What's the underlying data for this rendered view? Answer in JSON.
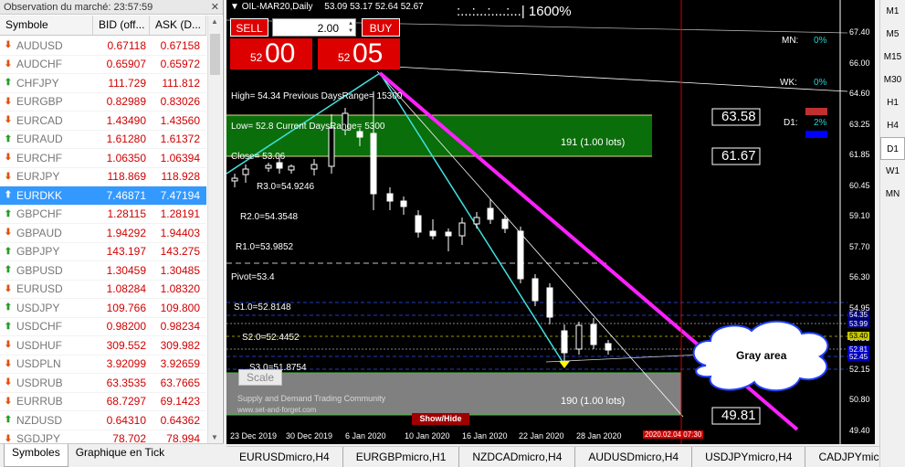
{
  "market_watch": {
    "title": "Observation du marché: 23:57:59",
    "close_icon": "close-icon",
    "columns": [
      "Symbole",
      "BID (off...",
      "ASK (D..."
    ],
    "rows": [
      {
        "symbol": "AUDUSD",
        "bid": "0.67118",
        "ask": "0.67158",
        "dir": "down"
      },
      {
        "symbol": "AUDCHF",
        "bid": "0.65907",
        "ask": "0.65972",
        "dir": "down"
      },
      {
        "symbol": "CHFJPY",
        "bid": "111.729",
        "ask": "111.812",
        "dir": "up"
      },
      {
        "symbol": "EURGBP",
        "bid": "0.82989",
        "ask": "0.83026",
        "dir": "down"
      },
      {
        "symbol": "EURCAD",
        "bid": "1.43490",
        "ask": "1.43560",
        "dir": "down"
      },
      {
        "symbol": "EURAUD",
        "bid": "1.61280",
        "ask": "1.61372",
        "dir": "up"
      },
      {
        "symbol": "EURCHF",
        "bid": "1.06350",
        "ask": "1.06394",
        "dir": "down"
      },
      {
        "symbol": "EURJPY",
        "bid": "118.869",
        "ask": "118.928",
        "dir": "down"
      },
      {
        "symbol": "EURDKK",
        "bid": "7.46871",
        "ask": "7.47194",
        "dir": "up",
        "selected": true
      },
      {
        "symbol": "GBPCHF",
        "bid": "1.28115",
        "ask": "1.28191",
        "dir": "up"
      },
      {
        "symbol": "GBPAUD",
        "bid": "1.94292",
        "ask": "1.94403",
        "dir": "down"
      },
      {
        "symbol": "GBPJPY",
        "bid": "143.197",
        "ask": "143.275",
        "dir": "up"
      },
      {
        "symbol": "GBPUSD",
        "bid": "1.30459",
        "ask": "1.30485",
        "dir": "up"
      },
      {
        "symbol": "EURUSD",
        "bid": "1.08284",
        "ask": "1.08320",
        "dir": "down"
      },
      {
        "symbol": "USDJPY",
        "bid": "109.766",
        "ask": "109.800",
        "dir": "up"
      },
      {
        "symbol": "USDCHF",
        "bid": "0.98200",
        "ask": "0.98234",
        "dir": "up"
      },
      {
        "symbol": "USDHUF",
        "bid": "309.552",
        "ask": "309.982",
        "dir": "down"
      },
      {
        "symbol": "USDPLN",
        "bid": "3.92099",
        "ask": "3.92659",
        "dir": "down"
      },
      {
        "symbol": "USDRUB",
        "bid": "63.3535",
        "ask": "63.7665",
        "dir": "down"
      },
      {
        "symbol": "EURRUB",
        "bid": "68.7297",
        "ask": "69.1423",
        "dir": "down"
      },
      {
        "symbol": "NZDUSD",
        "bid": "0.64310",
        "ask": "0.64362",
        "dir": "up"
      },
      {
        "symbol": "SGDJPY",
        "bid": "78.702",
        "ask": "78.994",
        "dir": "down"
      }
    ],
    "tabs": [
      "Symboles",
      "Graphique en Tick"
    ]
  },
  "chart": {
    "symbol_line": "OIL-MAR20,Daily",
    "ohlc": "53.09 53.17 52.64 52.67",
    "zoom_text": ":...:...:....:...|  1600%",
    "trade_panel": {
      "sell_label": "SELL",
      "buy_label": "BUY",
      "lot": "2.00",
      "sell_small": "52",
      "sell_big": "00",
      "buy_small": "52",
      "buy_big": "05"
    },
    "info_lines": [
      "High= 54.34 Previous DaysRange= 15300",
      "Low= 52.8 Current DaysRange= 5300",
      "Close= 53.06",
      "R3.0=54.9246",
      "R2.0=54.3548",
      "R1.0=53.9852",
      "Pivot=53.4",
      "S1.0=52.8148",
      "S2.0=52.4452",
      "S3.0=51.8754"
    ],
    "strength": [
      {
        "label": "MN:",
        "value": "0%"
      },
      {
        "label": "WK:",
        "value": "0%"
      },
      {
        "label": "D1:",
        "value": "2%"
      }
    ],
    "zone_top_label": "191 (1.00 lots)",
    "zone_bottom_label": "190 (1.00 lots)",
    "level_boxes": [
      "63.58",
      "61.67",
      "49.81"
    ],
    "scale_label": "Scale",
    "watermark_1": "Supply and Demand Trading Community",
    "watermark_2": "www.set-and-forget.com",
    "show_hide": "Show/Hide",
    "cloud_text": "Gray area",
    "price_axis": [
      "67.40",
      "66.00",
      "64.60",
      "63.25",
      "61.85",
      "60.45",
      "59.10",
      "57.70",
      "56.30",
      "54.95",
      "53.55",
      "52.15",
      "50.80",
      "49.40"
    ],
    "price_tags": [
      {
        "text": "54.35",
        "color": "#000080"
      },
      {
        "text": "53.99",
        "color": "#000080"
      },
      {
        "text": "53.40",
        "color": "#c8c800"
      },
      {
        "text": "52.81",
        "color": "#0000c0"
      },
      {
        "text": "52.45",
        "color": "#0000c0"
      }
    ],
    "date_axis": [
      "23 Dec 2019",
      "30 Dec 2019",
      "6 Jan 2020",
      "10 Jan 2020",
      "16 Jan 2020",
      "22 Jan 2020",
      "28 Jan 2020"
    ],
    "current_time": "2020.02.04 07:30"
  },
  "timeframes": [
    "M1",
    "M5",
    "M15",
    "M30",
    "H1",
    "H4",
    "D1",
    "W1",
    "MN"
  ],
  "active_timeframe": "D1",
  "chart_tabs": [
    "EURUSDmicro,H4",
    "EURGBPmicro,H1",
    "NZDCADmicro,H4",
    "AUDUSDmicro,H4",
    "USDJPYmicro,H4",
    "CADJPYmicro,H4"
  ]
}
